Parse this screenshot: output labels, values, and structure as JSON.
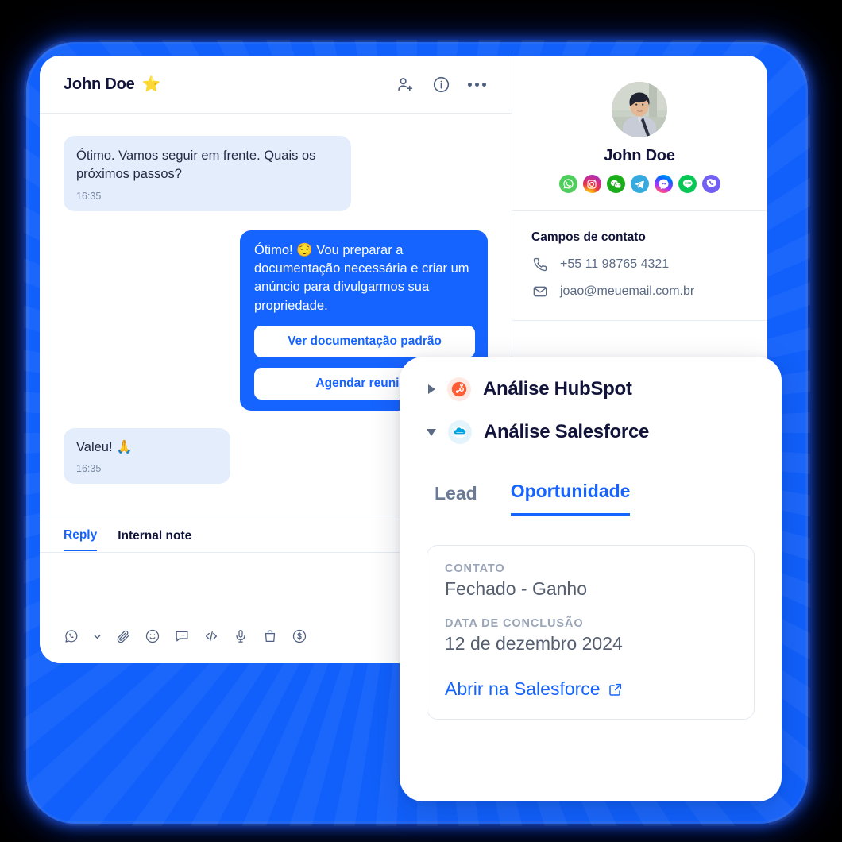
{
  "theme": {
    "accent": "#1664ff",
    "frame": "#1160fb",
    "bubble_in_bg": "#e3edfb",
    "text_dark": "#11133a",
    "text_muted": "#5b6a85",
    "background": "#000000"
  },
  "conversation": {
    "header": {
      "title": "John Doe",
      "star_icon": "star-icon",
      "actions": [
        {
          "icon": "add-user-icon"
        },
        {
          "icon": "info-circle-icon"
        },
        {
          "icon": "more-options-icon"
        }
      ]
    },
    "messages": [
      {
        "direction": "incoming",
        "text": "Ótimo. Vamos seguir em frente. Quais os próximos passos?",
        "time": "16:35"
      },
      {
        "direction": "outgoing",
        "text": "Ótimo! 😌 Vou preparar a documentação necessária e criar um anúncio para divulgarmos sua propriedade.",
        "buttons": [
          "Ver documentação padrão",
          "Agendar reunião"
        ]
      },
      {
        "direction": "incoming",
        "text": "Valeu! 🙏",
        "time": "16:35"
      }
    ],
    "composer": {
      "tabs": [
        {
          "label": "Reply",
          "active": true
        },
        {
          "label": "Internal note",
          "active": false
        }
      ],
      "tools": [
        "whatsapp-channel-icon",
        "chevron-down-icon",
        "attachment-icon",
        "emoji-icon",
        "quick-reply-icon",
        "code-snippet-icon",
        "microphone-icon",
        "product-bag-icon",
        "payment-dollar-icon"
      ]
    }
  },
  "contact_panel": {
    "avatar_alt": "John Doe avatar",
    "name": "John Doe",
    "channels": [
      {
        "name": "whatsapp-icon",
        "color": "#4fce5d"
      },
      {
        "name": "instagram-icon",
        "color": "#d6249f"
      },
      {
        "name": "wechat-icon",
        "color": "#1aad19"
      },
      {
        "name": "telegram-icon",
        "color": "#34aadf"
      },
      {
        "name": "messenger-icon",
        "color": "#a334fa"
      },
      {
        "name": "line-icon",
        "color": "#06c755"
      },
      {
        "name": "viber-icon",
        "color": "#7360f2"
      }
    ],
    "fields_title": "Campos de contato",
    "fields": [
      {
        "icon": "phone-icon",
        "value": "+55 11 98765 4321"
      },
      {
        "icon": "mail-icon",
        "value": "joao@meuemail.com.br"
      }
    ]
  },
  "overlay": {
    "accordions": [
      {
        "label": "Análise HubSpot",
        "expanded": false,
        "icon": "hubspot-icon",
        "icon_color": "#ff5c35"
      },
      {
        "label": "Análise Salesforce",
        "expanded": true,
        "icon": "salesforce-icon",
        "icon_color": "#00a1e0"
      }
    ],
    "tabs": [
      {
        "label": "Lead",
        "active": false
      },
      {
        "label": "Oportunidade",
        "active": true
      }
    ],
    "card": {
      "rows": [
        {
          "label": "CONTATO",
          "value": "Fechado - Ganho"
        },
        {
          "label": "DATA DE CONCLUSÃO",
          "value": "12 de dezembro 2024"
        }
      ],
      "link": {
        "label": "Abrir na Salesforce",
        "icon": "external-link-icon"
      }
    }
  }
}
